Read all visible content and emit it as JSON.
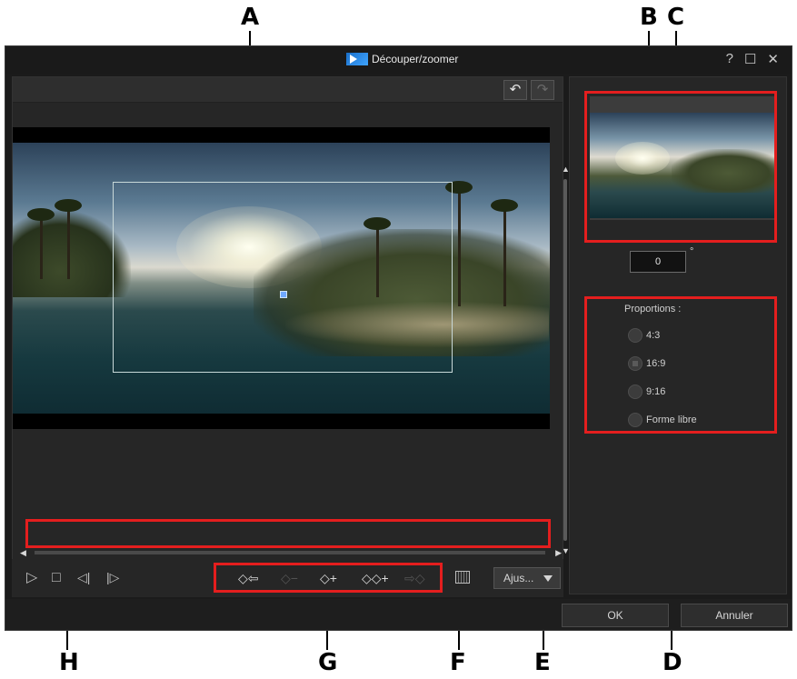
{
  "window": {
    "title": "Découper/zoomer",
    "help": "?",
    "maximize": "☐",
    "close": "✕"
  },
  "callouts": [
    "A",
    "B",
    "C",
    "D",
    "E",
    "F",
    "G",
    "H"
  ],
  "toolbar": {
    "undo_icon": "↶",
    "redo_icon": "↷"
  },
  "playback": {
    "play": "▷",
    "stop": "□",
    "prev_frame": "◁|",
    "next_frame": "|▷"
  },
  "keyframes": {
    "add_prev": "◇⇦",
    "remove": "◇−",
    "add": "◇+",
    "duplicate": "◇◇+",
    "add_next": "⇨◇"
  },
  "adjust": {
    "label": "Ajus..."
  },
  "rotation": {
    "value": "0",
    "unit": "°"
  },
  "proportions": {
    "label": "Proportions :",
    "options": [
      {
        "label": "4:3",
        "checked": false
      },
      {
        "label": "16:9",
        "checked": true
      },
      {
        "label": "9:16",
        "checked": false
      },
      {
        "label": "Forme libre",
        "checked": false
      }
    ]
  },
  "footer": {
    "ok": "OK",
    "cancel": "Annuler"
  },
  "icons": {
    "scroll_up": "▲",
    "scroll_down": "▼",
    "scroll_left": "◀",
    "scroll_right": "▶"
  },
  "colors": {
    "callout_box": "#e41e1e",
    "window_bg": "#1b1b1b",
    "panel_bg": "#262626"
  }
}
